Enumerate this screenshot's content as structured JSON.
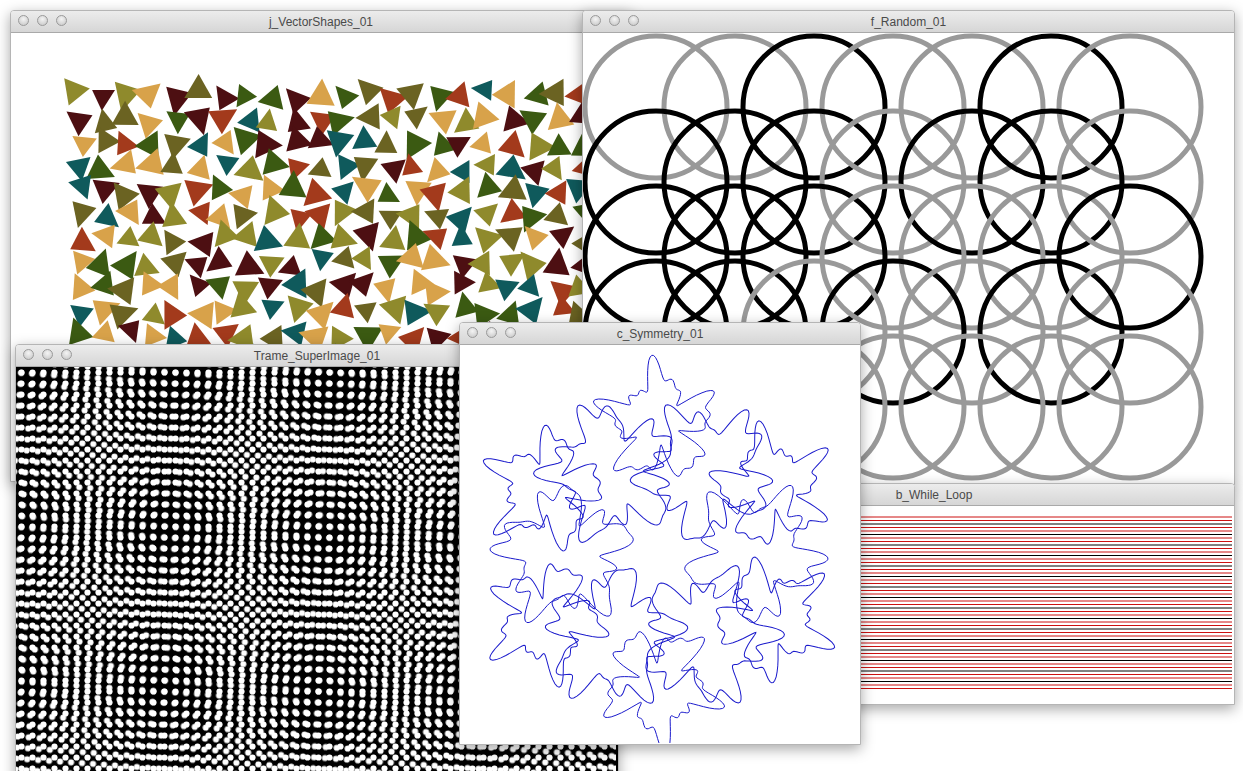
{
  "windows": [
    {
      "title": "j_VectorShapes_01",
      "kind": "triangles",
      "palette": [
        "#0f5a5c",
        "#8f8a2c",
        "#4d0f12",
        "#a33a1c",
        "#d8a24a",
        "#3b5a12",
        "#6b6322"
      ]
    },
    {
      "title": "f_Random_01",
      "kind": "circles",
      "rows": [
        [
          "#999999",
          "#999999",
          "#000000",
          "#999999",
          "#999999",
          "#000000",
          "#999999"
        ],
        [
          "#000000",
          "#000000",
          "#000000",
          "#999999",
          "#000000",
          "#000000",
          "#999999"
        ],
        [
          "#000000",
          "#000000",
          "#000000",
          "#999999",
          "#999999",
          "#999999",
          "#000000"
        ],
        [
          "#000000",
          "#000000",
          "#999999",
          "#000000",
          "#999999",
          "#000000",
          "#999999"
        ],
        [
          "#999999",
          "#999999",
          "#999999",
          "#999999",
          "#999999",
          "#999999",
          "#999999"
        ]
      ]
    },
    {
      "title": "Trame_SuperImage_01",
      "kind": "moire",
      "colors": [
        "#000000",
        "#ffffff"
      ]
    },
    {
      "title": "b_While_Loop",
      "kind": "lines",
      "colors": [
        "#cc1111",
        "#000000"
      ]
    },
    {
      "title": "c_Symmetry_01",
      "kind": "symmetry",
      "colors": [
        "#1a1acc"
      ]
    }
  ]
}
